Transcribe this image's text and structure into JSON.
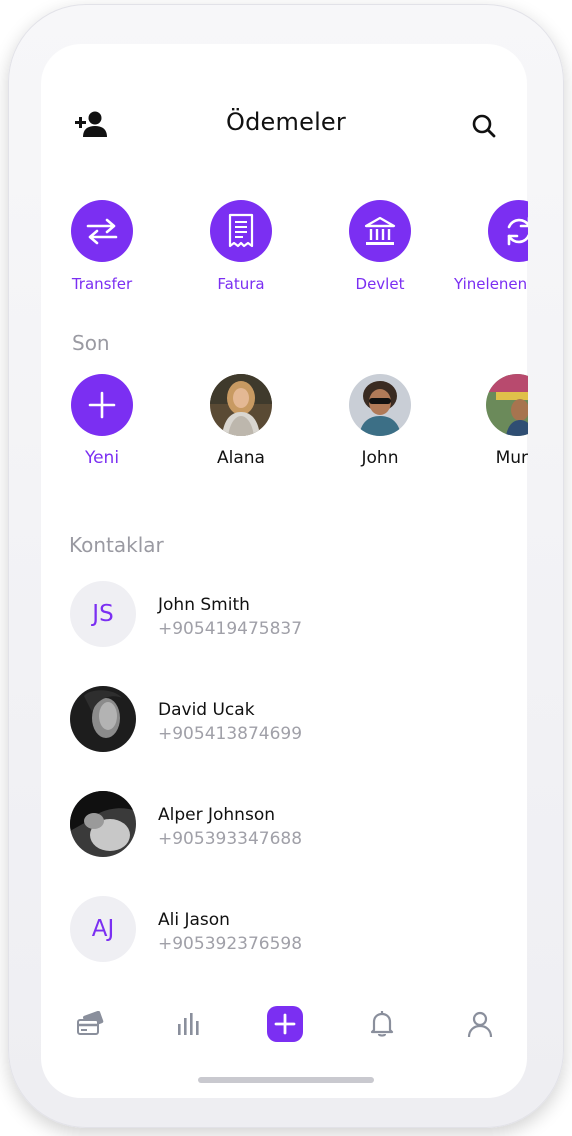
{
  "header": {
    "title": "Ödemeler"
  },
  "quick_actions": [
    {
      "label": "Transfer",
      "icon": "swap-arrows-icon"
    },
    {
      "label": "Fatura",
      "icon": "receipt-icon"
    },
    {
      "label": "Devlet",
      "icon": "bank-icon"
    },
    {
      "label": "Yinelenen",
      "icon": "repeat-icon"
    }
  ],
  "recent": {
    "title": "Son",
    "items": [
      {
        "name": "Yeni",
        "type": "new"
      },
      {
        "name": "Alana",
        "type": "photo"
      },
      {
        "name": "John",
        "type": "photo"
      },
      {
        "name": "Mura",
        "type": "photo"
      }
    ]
  },
  "contacts": {
    "title": "Kontaklar",
    "items": [
      {
        "initials": "JS",
        "name": "John Smith",
        "phone": "+905419475837"
      },
      {
        "initials": "",
        "name": "David Ucak",
        "phone": "+905413874699"
      },
      {
        "initials": "",
        "name": "Alper Johnson",
        "phone": "+905393347688"
      },
      {
        "initials": "AJ",
        "name": "Ali Jason",
        "phone": "+905392376598"
      }
    ]
  },
  "tabbar": {
    "items": [
      "cards-icon",
      "stats-icon",
      "plus-icon",
      "bell-icon",
      "profile-icon"
    ]
  },
  "colors": {
    "accent": "#7b2ff2",
    "muted": "#a0a0a8",
    "icon": "#8a8f9c"
  }
}
